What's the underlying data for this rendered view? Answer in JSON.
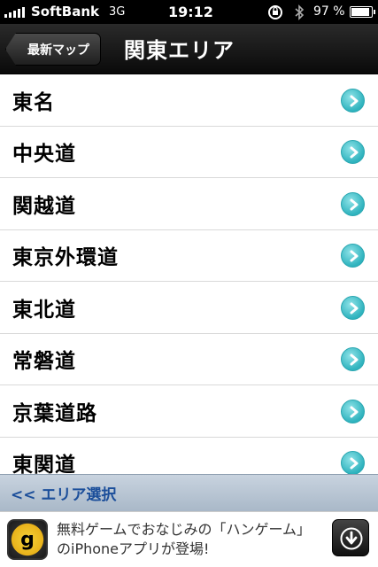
{
  "status_bar": {
    "carrier": "SoftBank",
    "network": "3G",
    "time": "19:12",
    "battery_percent": "97 %",
    "battery_level": 0.97
  },
  "nav": {
    "back_label": "最新マップ",
    "title": "関東エリア"
  },
  "list": {
    "items": [
      {
        "label": "東名"
      },
      {
        "label": "中央道"
      },
      {
        "label": "関越道"
      },
      {
        "label": "東京外環道"
      },
      {
        "label": "東北道"
      },
      {
        "label": "常磐道"
      },
      {
        "label": "京葉道路"
      },
      {
        "label": "東関道"
      }
    ]
  },
  "area_select": {
    "label": "<< エリア選択"
  },
  "ad": {
    "icon_letter": "g",
    "text": "無料ゲームでおなじみの「ハンゲーム」のiPhoneアプリが登場!"
  },
  "colors": {
    "accent": "#2fb3be",
    "link": "#1b4e9a"
  }
}
